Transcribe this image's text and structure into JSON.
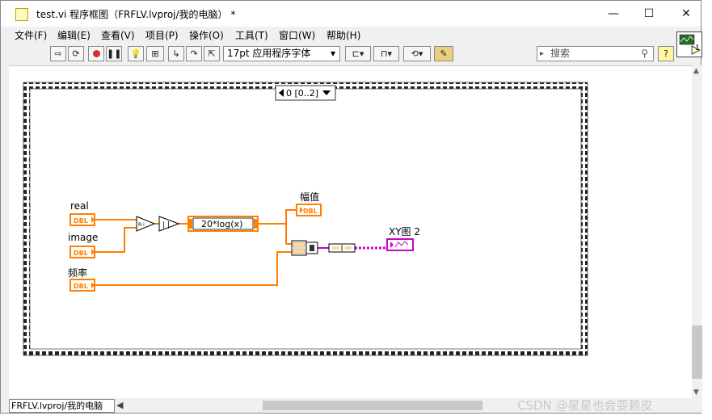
{
  "window": {
    "title": "test.vi 程序框图（FRFLV.lvproj/我的电脑） *",
    "controls": {
      "minimize": "—",
      "maximize": "☐",
      "close": "✕"
    }
  },
  "menu": [
    "文件(F)",
    "编辑(E)",
    "查看(V)",
    "项目(P)",
    "操作(O)",
    "工具(T)",
    "窗口(W)",
    "帮助(H)"
  ],
  "toolbar": {
    "font": "17pt 应用程序字体",
    "search_placeholder": "搜索",
    "help": "?"
  },
  "diagram": {
    "case_selector": "0 [0..2]",
    "labels": {
      "real": "real",
      "image": "image",
      "freq": "频率",
      "mag": "幅值",
      "xy": "XY图 2",
      "formula": "20*log(x)"
    },
    "terminals": {
      "dbl": "DBL"
    },
    "wire_colors": {
      "numeric": "#ff7f00",
      "cluster": "#cc00cc"
    }
  },
  "status": {
    "context": "FRFLV.lvproj/我的电脑"
  },
  "watermark": "CSDN @星星也会耍赖皮",
  "connector_pane": {
    "index": "1"
  }
}
